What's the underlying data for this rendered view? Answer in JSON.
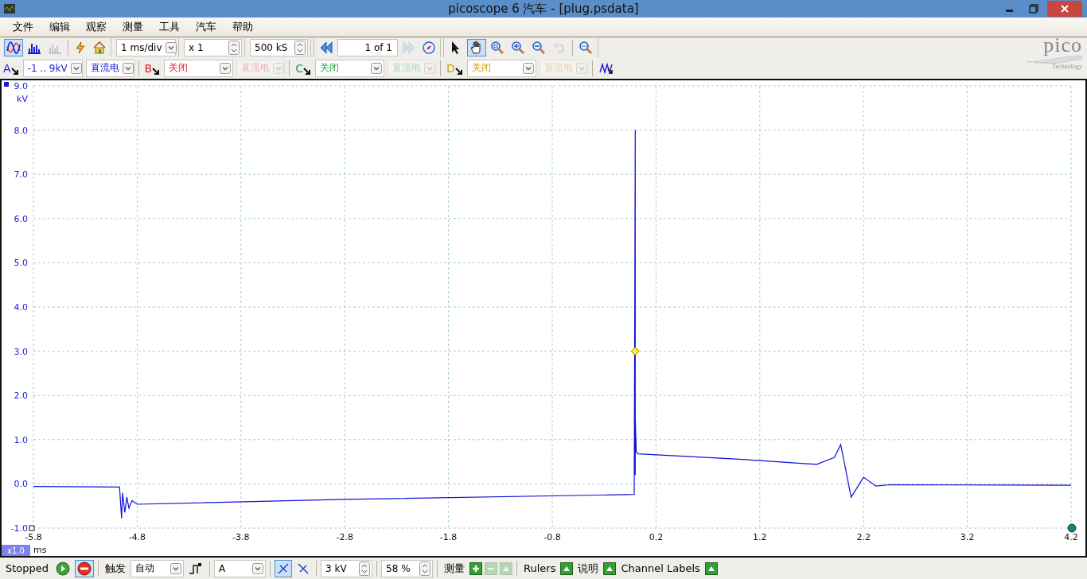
{
  "window": {
    "title": "picoscope 6 汽车 - [plug.psdata]"
  },
  "menu": [
    "文件",
    "编辑",
    "观察",
    "测量",
    "工具",
    "汽车",
    "帮助"
  ],
  "toolbar": {
    "modes": [
      {
        "kind": "scope",
        "selected": true,
        "disabled": false
      },
      {
        "kind": "spectrum",
        "selected": false,
        "disabled": false
      },
      {
        "kind": "persistence",
        "selected": false,
        "disabled": true
      }
    ],
    "timebase": "1 ms/div",
    "zoom": "x 1",
    "samples": "500 kS",
    "buffer": "1 of 1",
    "next_buffer_disabled": true,
    "tools": [
      {
        "kind": "pointer",
        "selected": false,
        "disabled": false
      },
      {
        "kind": "hand",
        "selected": true,
        "disabled": false
      },
      {
        "kind": "zoom-area",
        "selected": false,
        "disabled": false
      },
      {
        "kind": "zoom-in",
        "selected": false,
        "disabled": false
      },
      {
        "kind": "zoom-out",
        "selected": false,
        "disabled": false
      },
      {
        "kind": "undo",
        "selected": false,
        "disabled": true
      },
      {
        "kind": "zoom-fit",
        "selected": false,
        "disabled": false
      }
    ]
  },
  "logo": {
    "name": "pico",
    "tagline": "Technology"
  },
  "channels": [
    {
      "letter": "A",
      "color": "#1a1ad8",
      "range": "-1 .. 9kV",
      "range_disabled": false,
      "coupling": "直流电",
      "coupling_disabled": false
    },
    {
      "letter": "B",
      "color": "#e0202a",
      "range": "关闭",
      "range_disabled": false,
      "coupling": "直流电",
      "coupling_disabled": true
    },
    {
      "letter": "C",
      "color": "#20a040",
      "range": "关闭",
      "range_disabled": false,
      "coupling": "直流电",
      "coupling_disabled": true
    },
    {
      "letter": "D",
      "color": "#c8a000",
      "range": "关闭",
      "range_disabled": false,
      "coupling": "直流电",
      "coupling_disabled": true
    }
  ],
  "plot": {
    "zoom_badge": "x1.0",
    "chart_data": {
      "type": "line",
      "xlabel": "ms",
      "ylabel": "kV",
      "x": [
        -5.8,
        -4.97,
        -4.95,
        -4.94,
        -4.92,
        -4.9,
        -4.88,
        -4.85,
        -4.8,
        -2.8,
        -0.01,
        0.0,
        0.0,
        0.0,
        0.01,
        0.03,
        1.0,
        1.75,
        1.92,
        1.98,
        2.08,
        2.2,
        2.32,
        2.45,
        4.2
      ],
      "grid": true,
      "series": [
        {
          "color": "#1010d8",
          "values": [
            -0.06,
            -0.07,
            -0.78,
            -0.2,
            -0.65,
            -0.3,
            -0.55,
            -0.38,
            -0.46,
            -0.35,
            -0.24,
            8.0,
            0.2,
            1.5,
            0.72,
            0.68,
            0.56,
            0.44,
            0.6,
            0.89,
            -0.3,
            0.15,
            -0.05,
            -0.02,
            -0.03
          ]
        }
      ],
      "xlim": [
        -5.8,
        4.2
      ],
      "ylim": [
        -1,
        9
      ],
      "xticks": [
        -5.8,
        -4.8,
        -3.8,
        -2.8,
        -1.8,
        -0.8,
        0.2,
        1.2,
        2.2,
        3.2,
        4.2
      ],
      "yticks": [
        {
          "value": -1,
          "label": "-1.0"
        },
        {
          "value": 0,
          "label": "0.0"
        },
        {
          "value": 1,
          "label": "1.0"
        },
        {
          "value": 2,
          "label": "2.0"
        },
        {
          "value": 3,
          "label": "3.0"
        },
        {
          "value": 4,
          "label": "4.0"
        },
        {
          "value": 5,
          "label": "5.0"
        },
        {
          "value": 6,
          "label": "6.0"
        },
        {
          "value": 7,
          "label": "7.0"
        },
        {
          "value": 8,
          "label": "8.0"
        },
        {
          "value": 9,
          "label": "9.0"
        }
      ]
    }
  },
  "status_bar": {
    "state": "Stopped",
    "run_controls": [
      {
        "kind": "run",
        "selected": false
      },
      {
        "kind": "stop",
        "selected": true
      }
    ],
    "trigger_label": "触发",
    "trigger_mode": "自动",
    "trigger_source": "A",
    "edges": [
      {
        "kind": "rising",
        "selected": true
      },
      {
        "kind": "falling",
        "selected": false
      }
    ],
    "threshold": "3 kV",
    "pretrigger": "58 %",
    "measurements": {
      "label": "测量",
      "buttons": [
        {
          "kind": "add",
          "disabled": false
        },
        {
          "kind": "delete",
          "disabled": true
        },
        {
          "kind": "edit",
          "disabled": true
        }
      ]
    },
    "toggles": [
      {
        "label": "Rulers"
      },
      {
        "label": "说明"
      },
      {
        "label": "Channel Labels"
      }
    ]
  }
}
